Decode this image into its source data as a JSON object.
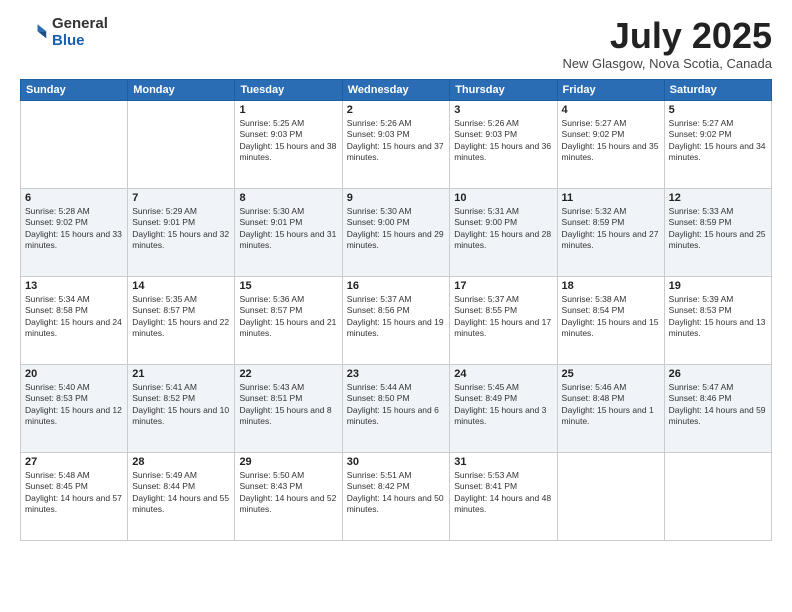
{
  "logo": {
    "general": "General",
    "blue": "Blue"
  },
  "title": "July 2025",
  "location": "New Glasgow, Nova Scotia, Canada",
  "weekdays": [
    "Sunday",
    "Monday",
    "Tuesday",
    "Wednesday",
    "Thursday",
    "Friday",
    "Saturday"
  ],
  "weeks": [
    [
      {
        "day": "",
        "sunrise": "",
        "sunset": "",
        "daylight": ""
      },
      {
        "day": "",
        "sunrise": "",
        "sunset": "",
        "daylight": ""
      },
      {
        "day": "1",
        "sunrise": "Sunrise: 5:25 AM",
        "sunset": "Sunset: 9:03 PM",
        "daylight": "Daylight: 15 hours and 38 minutes."
      },
      {
        "day": "2",
        "sunrise": "Sunrise: 5:26 AM",
        "sunset": "Sunset: 9:03 PM",
        "daylight": "Daylight: 15 hours and 37 minutes."
      },
      {
        "day": "3",
        "sunrise": "Sunrise: 5:26 AM",
        "sunset": "Sunset: 9:03 PM",
        "daylight": "Daylight: 15 hours and 36 minutes."
      },
      {
        "day": "4",
        "sunrise": "Sunrise: 5:27 AM",
        "sunset": "Sunset: 9:02 PM",
        "daylight": "Daylight: 15 hours and 35 minutes."
      },
      {
        "day": "5",
        "sunrise": "Sunrise: 5:27 AM",
        "sunset": "Sunset: 9:02 PM",
        "daylight": "Daylight: 15 hours and 34 minutes."
      }
    ],
    [
      {
        "day": "6",
        "sunrise": "Sunrise: 5:28 AM",
        "sunset": "Sunset: 9:02 PM",
        "daylight": "Daylight: 15 hours and 33 minutes."
      },
      {
        "day": "7",
        "sunrise": "Sunrise: 5:29 AM",
        "sunset": "Sunset: 9:01 PM",
        "daylight": "Daylight: 15 hours and 32 minutes."
      },
      {
        "day": "8",
        "sunrise": "Sunrise: 5:30 AM",
        "sunset": "Sunset: 9:01 PM",
        "daylight": "Daylight: 15 hours and 31 minutes."
      },
      {
        "day": "9",
        "sunrise": "Sunrise: 5:30 AM",
        "sunset": "Sunset: 9:00 PM",
        "daylight": "Daylight: 15 hours and 29 minutes."
      },
      {
        "day": "10",
        "sunrise": "Sunrise: 5:31 AM",
        "sunset": "Sunset: 9:00 PM",
        "daylight": "Daylight: 15 hours and 28 minutes."
      },
      {
        "day": "11",
        "sunrise": "Sunrise: 5:32 AM",
        "sunset": "Sunset: 8:59 PM",
        "daylight": "Daylight: 15 hours and 27 minutes."
      },
      {
        "day": "12",
        "sunrise": "Sunrise: 5:33 AM",
        "sunset": "Sunset: 8:59 PM",
        "daylight": "Daylight: 15 hours and 25 minutes."
      }
    ],
    [
      {
        "day": "13",
        "sunrise": "Sunrise: 5:34 AM",
        "sunset": "Sunset: 8:58 PM",
        "daylight": "Daylight: 15 hours and 24 minutes."
      },
      {
        "day": "14",
        "sunrise": "Sunrise: 5:35 AM",
        "sunset": "Sunset: 8:57 PM",
        "daylight": "Daylight: 15 hours and 22 minutes."
      },
      {
        "day": "15",
        "sunrise": "Sunrise: 5:36 AM",
        "sunset": "Sunset: 8:57 PM",
        "daylight": "Daylight: 15 hours and 21 minutes."
      },
      {
        "day": "16",
        "sunrise": "Sunrise: 5:37 AM",
        "sunset": "Sunset: 8:56 PM",
        "daylight": "Daylight: 15 hours and 19 minutes."
      },
      {
        "day": "17",
        "sunrise": "Sunrise: 5:37 AM",
        "sunset": "Sunset: 8:55 PM",
        "daylight": "Daylight: 15 hours and 17 minutes."
      },
      {
        "day": "18",
        "sunrise": "Sunrise: 5:38 AM",
        "sunset": "Sunset: 8:54 PM",
        "daylight": "Daylight: 15 hours and 15 minutes."
      },
      {
        "day": "19",
        "sunrise": "Sunrise: 5:39 AM",
        "sunset": "Sunset: 8:53 PM",
        "daylight": "Daylight: 15 hours and 13 minutes."
      }
    ],
    [
      {
        "day": "20",
        "sunrise": "Sunrise: 5:40 AM",
        "sunset": "Sunset: 8:53 PM",
        "daylight": "Daylight: 15 hours and 12 minutes."
      },
      {
        "day": "21",
        "sunrise": "Sunrise: 5:41 AM",
        "sunset": "Sunset: 8:52 PM",
        "daylight": "Daylight: 15 hours and 10 minutes."
      },
      {
        "day": "22",
        "sunrise": "Sunrise: 5:43 AM",
        "sunset": "Sunset: 8:51 PM",
        "daylight": "Daylight: 15 hours and 8 minutes."
      },
      {
        "day": "23",
        "sunrise": "Sunrise: 5:44 AM",
        "sunset": "Sunset: 8:50 PM",
        "daylight": "Daylight: 15 hours and 6 minutes."
      },
      {
        "day": "24",
        "sunrise": "Sunrise: 5:45 AM",
        "sunset": "Sunset: 8:49 PM",
        "daylight": "Daylight: 15 hours and 3 minutes."
      },
      {
        "day": "25",
        "sunrise": "Sunrise: 5:46 AM",
        "sunset": "Sunset: 8:48 PM",
        "daylight": "Daylight: 15 hours and 1 minute."
      },
      {
        "day": "26",
        "sunrise": "Sunrise: 5:47 AM",
        "sunset": "Sunset: 8:46 PM",
        "daylight": "Daylight: 14 hours and 59 minutes."
      }
    ],
    [
      {
        "day": "27",
        "sunrise": "Sunrise: 5:48 AM",
        "sunset": "Sunset: 8:45 PM",
        "daylight": "Daylight: 14 hours and 57 minutes."
      },
      {
        "day": "28",
        "sunrise": "Sunrise: 5:49 AM",
        "sunset": "Sunset: 8:44 PM",
        "daylight": "Daylight: 14 hours and 55 minutes."
      },
      {
        "day": "29",
        "sunrise": "Sunrise: 5:50 AM",
        "sunset": "Sunset: 8:43 PM",
        "daylight": "Daylight: 14 hours and 52 minutes."
      },
      {
        "day": "30",
        "sunrise": "Sunrise: 5:51 AM",
        "sunset": "Sunset: 8:42 PM",
        "daylight": "Daylight: 14 hours and 50 minutes."
      },
      {
        "day": "31",
        "sunrise": "Sunrise: 5:53 AM",
        "sunset": "Sunset: 8:41 PM",
        "daylight": "Daylight: 14 hours and 48 minutes."
      },
      {
        "day": "",
        "sunrise": "",
        "sunset": "",
        "daylight": ""
      },
      {
        "day": "",
        "sunrise": "",
        "sunset": "",
        "daylight": ""
      }
    ]
  ]
}
